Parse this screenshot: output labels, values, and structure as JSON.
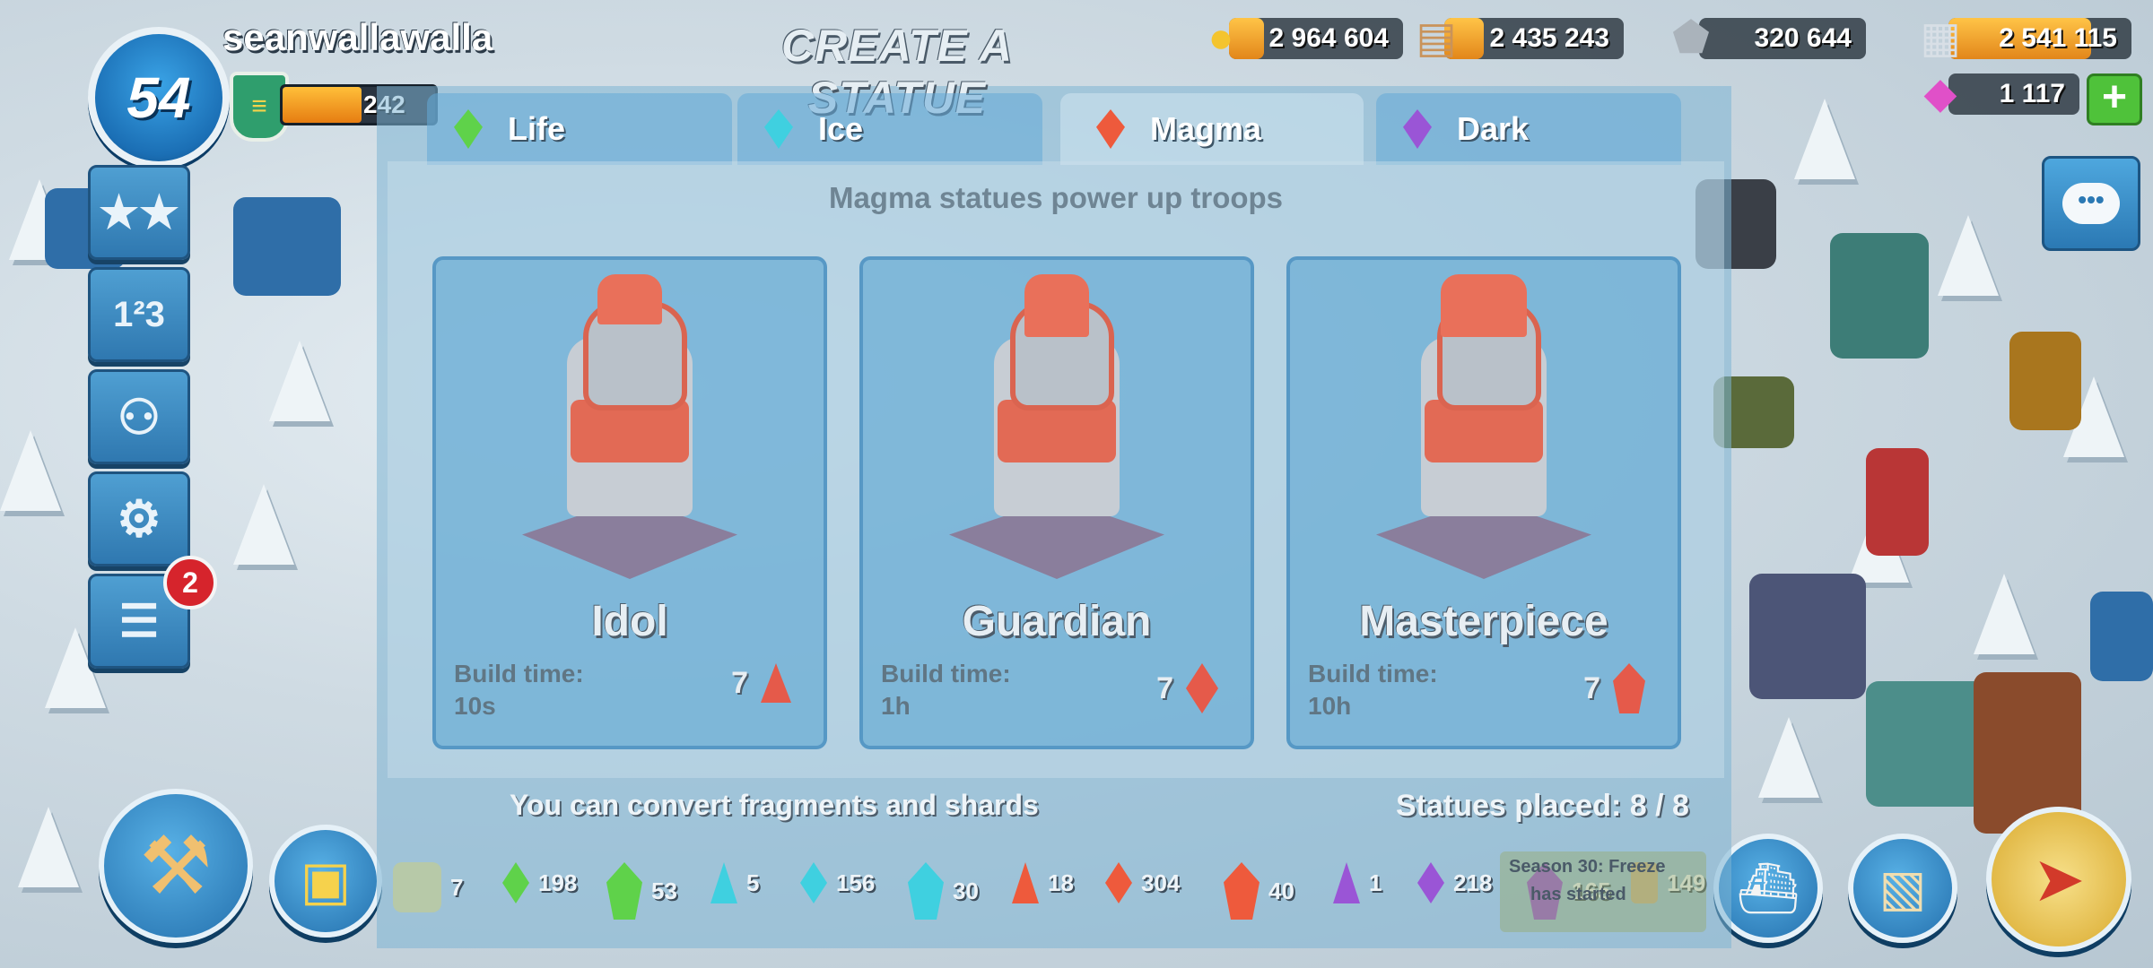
{
  "player": {
    "name": "seanwallawalla",
    "level": "54",
    "rank_points": "242"
  },
  "resources": {
    "gold": "2 964 604",
    "wood": "2 435 243",
    "stone": "320 644",
    "iron": "2 541 115",
    "diamonds": "1 117",
    "add_label": "+"
  },
  "side_menu": {
    "news_badge": "2"
  },
  "modal": {
    "title": "CREATE A STATUE",
    "tabs": [
      {
        "label": "Life",
        "gem_color": "#5fd24a"
      },
      {
        "label": "Ice",
        "gem_color": "#3fd0e0"
      },
      {
        "label": "Magma",
        "gem_color": "#ee5a3c"
      },
      {
        "label": "Dark",
        "gem_color": "#9a55d6"
      }
    ],
    "active_tab": "Magma",
    "subtitle": "Magma statues power up troops",
    "build_time_label": "Build time:",
    "cards": [
      {
        "name": "Idol",
        "build_time": "10s",
        "cost": "7",
        "cost_type": "fragment"
      },
      {
        "name": "Guardian",
        "build_time": "1h",
        "cost": "7",
        "cost_type": "shard"
      },
      {
        "name": "Masterpiece",
        "build_time": "10h",
        "cost": "7",
        "cost_type": "crystal"
      }
    ],
    "convert_text": "You can convert fragments and shards",
    "statues_placed": "Statues placed: 8 / 8",
    "inventory": [
      {
        "value": "7",
        "kind": "converter",
        "color": "#b7c9a8"
      },
      {
        "value": "198",
        "kind": "life-fragment",
        "color": "#5fd24a"
      },
      {
        "value": "53",
        "kind": "life-shard",
        "color": "#5fd24a"
      },
      {
        "value": "5",
        "kind": "ice-fragment",
        "color": "#3fd0e0"
      },
      {
        "value": "156",
        "kind": "ice-shard",
        "color": "#3fd0e0"
      },
      {
        "value": "30",
        "kind": "ice-crystal",
        "color": "#3fd0e0"
      },
      {
        "value": "18",
        "kind": "magma-fragment",
        "color": "#ee5a3c"
      },
      {
        "value": "304",
        "kind": "magma-shard",
        "color": "#ee5a3c"
      },
      {
        "value": "40",
        "kind": "magma-crystal",
        "color": "#ee5a3c"
      },
      {
        "value": "1",
        "kind": "dark-fragment",
        "color": "#9a55d6"
      },
      {
        "value": "218",
        "kind": "dark-shard",
        "color": "#9a55d6"
      },
      {
        "value": "165",
        "kind": "dark-crystal",
        "color": "#9a55d6"
      },
      {
        "value": "149",
        "kind": "other",
        "color": "#c9b38a"
      }
    ]
  },
  "event_banner": {
    "line1": "Season 30: Freeze",
    "line2": "has started"
  }
}
